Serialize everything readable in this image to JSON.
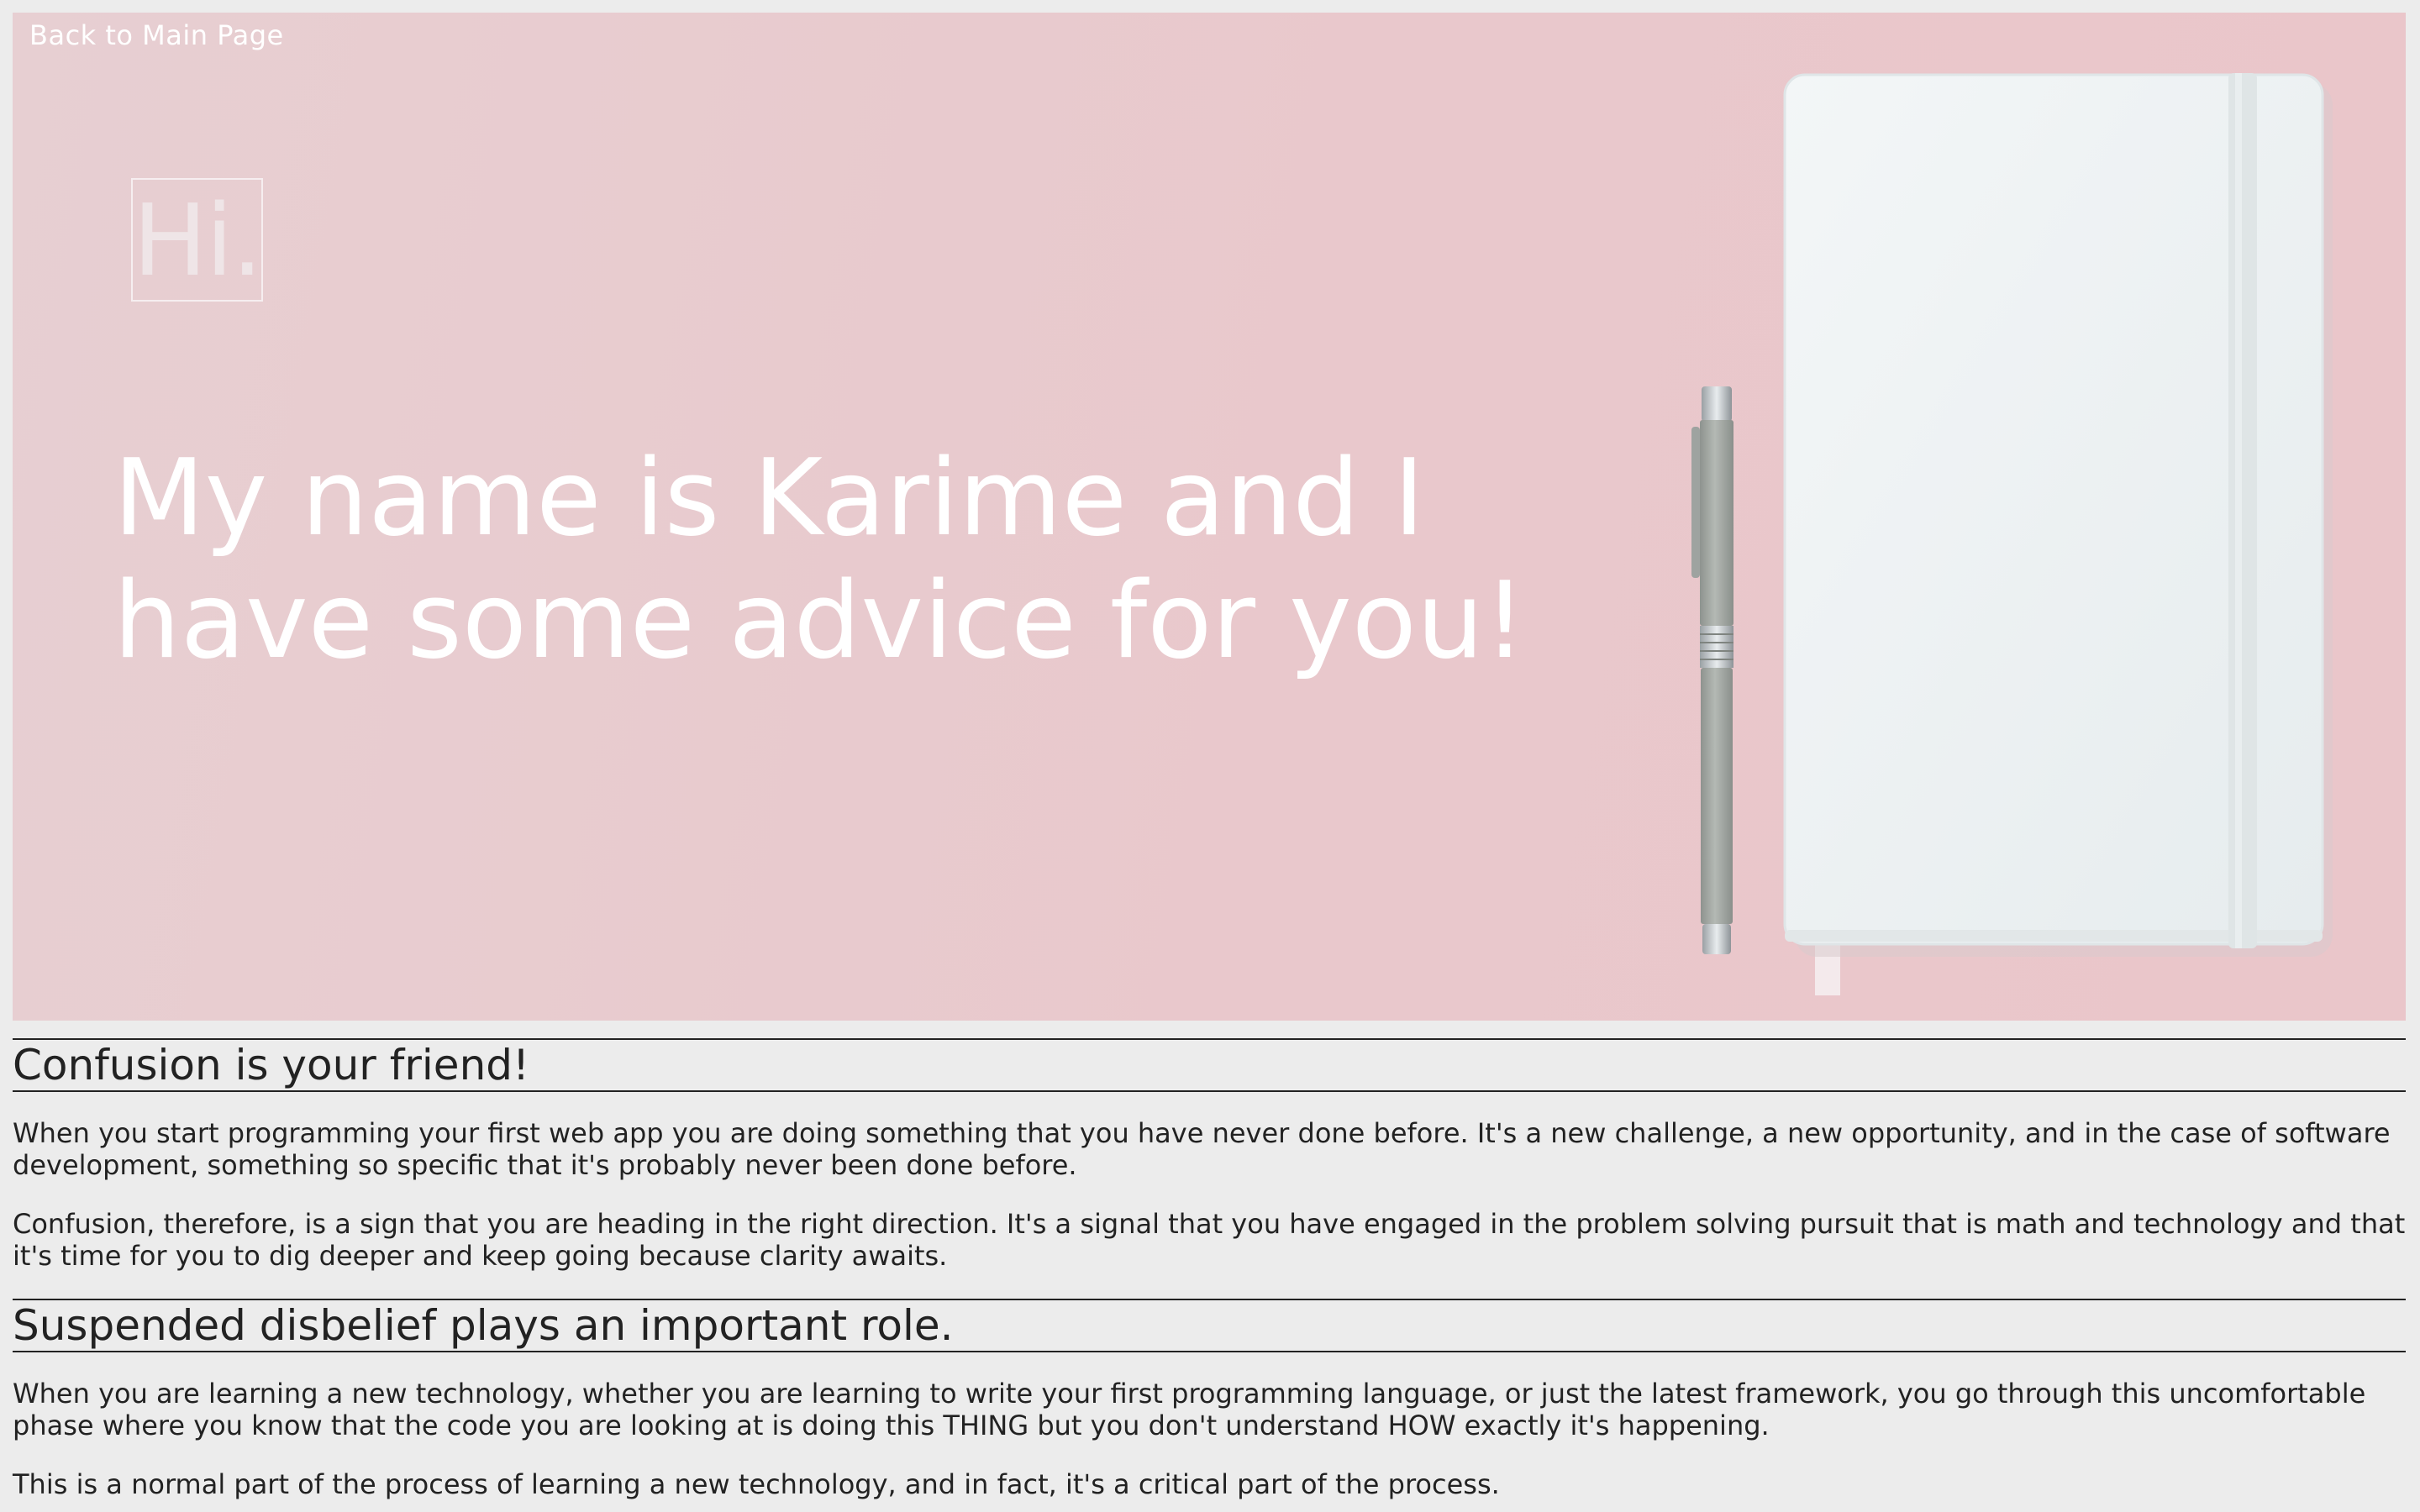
{
  "nav": {
    "back_label": "Back to Main Page"
  },
  "hero": {
    "greeting": "Hi.",
    "headline": "My name is Karime and I have some advice for you!"
  },
  "sections": [
    {
      "title": "Confusion is your friend!",
      "paragraphs": [
        "When you start programming your first web app you are doing something that you have never done before. It's a new challenge, a new opportunity, and in the case of software development, something so specific that it's probably never been done before.",
        "Confusion, therefore, is a sign that you are heading in the right direction. It's a signal that you have engaged in the problem solving pursuit that is math and technology and that it's time for you to dig deeper and keep going because clarity awaits."
      ]
    },
    {
      "title": "Suspended disbelief plays an important role.",
      "paragraphs": [
        "When you are learning a new technology, whether you are learning to write your first programming language, or just the latest framework, you go through this uncomfortable phase where you know that the code you are looking at is doing this THING but you don't understand HOW exactly it's happening.",
        "This is a normal part of the process of learning a new technology, and in fact, it's a critical part of the process."
      ]
    }
  ],
  "colors": {
    "page_background": "#ececec",
    "hero_pink": "#e9c8cc",
    "text_dark": "#222222",
    "hero_text": "#ffffff"
  },
  "icons": {
    "pen": "pen-icon",
    "notebook": "notebook-icon"
  }
}
